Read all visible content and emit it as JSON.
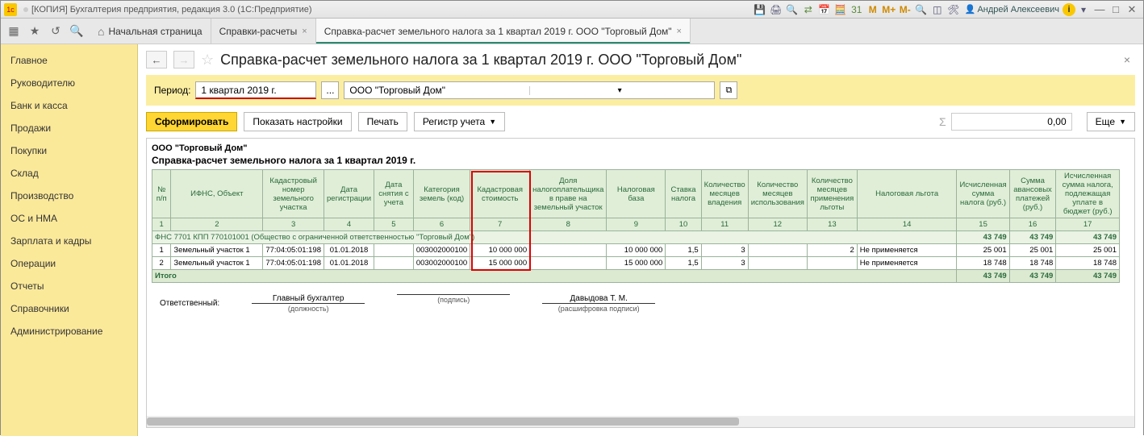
{
  "window": {
    "title": "[КОПИЯ] Бухгалтерия предприятия, редакция 3.0  (1С:Предприятие)",
    "user": "Андрей Алексеевич"
  },
  "toolbarIcons": {
    "m1": "M",
    "m2": "M+",
    "m3": "M-"
  },
  "tabs": {
    "home": "Начальная страница",
    "t1": "Справки-расчеты",
    "t2": "Справка-расчет земельного налога за 1 квартал 2019 г. ООО \"Торговый Дом\""
  },
  "sidebar": {
    "items": [
      "Главное",
      "Руководителю",
      "Банк и касса",
      "Продажи",
      "Покупки",
      "Склад",
      "Производство",
      "ОС и НМА",
      "Зарплата и кадры",
      "Операции",
      "Отчеты",
      "Справочники",
      "Администрирование"
    ]
  },
  "page": {
    "title": "Справка-расчет земельного налога за 1 квартал 2019 г. ООО \"Торговый Дом\"",
    "periodLabel": "Период:",
    "periodValue": "1 квартал 2019 г.",
    "org": "ООО \"Торговый Дом\"",
    "btnForm": "Сформировать",
    "btnSettings": "Показать настройки",
    "btnPrint": "Печать",
    "btnRegister": "Регистр учета",
    "sum": "0,00",
    "btnMore": "Еще"
  },
  "report": {
    "org": "ООО \"Торговый Дом\"",
    "title": "Справка-расчет земельного налога за 1 квартал 2019 г.",
    "headers": [
      "№ п/п",
      "ИФНС, Объект",
      "Кадастровый номер земельного участка",
      "Дата регистрации",
      "Дата снятия с учета",
      "Категория земель (код)",
      "Кадастровая стоимость",
      "Доля налогоплательщика в праве на земельный участок",
      "Налоговая база",
      "Ставка налога",
      "Количество месяцев владения",
      "Количество месяцев использования",
      "Количество месяцев применения льготы",
      "Налоговая льгота",
      "Исчисленная сумма налога (руб.)",
      "Сумма авансовых платежей (руб.)",
      "Исчисленная сумма налога, подлежащая уплате в бюджет (руб.)"
    ],
    "nums": [
      "1",
      "2",
      "3",
      "4",
      "5",
      "6",
      "7",
      "8",
      "9",
      "10",
      "11",
      "12",
      "13",
      "14",
      "15",
      "16",
      "17"
    ],
    "group": {
      "label": "ФНС 7701 КПП 770101001 (Общество с ограниченной ответственностью \"Торговый Дом\")",
      "v15": "43 749",
      "v16": "43 749",
      "v17": "43 749"
    },
    "rows": [
      {
        "n": "1",
        "obj": "Земельный участок 1",
        "kad": "77:04:05:01:198",
        "dreg": "01.01.2018",
        "dsn": "",
        "cat": "003002000100",
        "cost": "10 000 000",
        "share": "",
        "base": "10 000 000",
        "rate": "1,5",
        "mown": "3",
        "muse": "",
        "mlg": "2",
        "lg": "Не применяется",
        "s15": "25 001",
        "s16": "25 001",
        "s17": "25 001"
      },
      {
        "n": "2",
        "obj": "Земельный участок 1",
        "kad": "77:04:05:01:198",
        "dreg": "01.01.2018",
        "dsn": "",
        "cat": "003002000100",
        "cost": "15 000 000",
        "share": "",
        "base": "15 000 000",
        "rate": "1,5",
        "mown": "3",
        "muse": "",
        "mlg": "",
        "lg": "Не применяется",
        "s15": "18 748",
        "s16": "18 748",
        "s17": "18 748"
      }
    ],
    "total": {
      "label": "Итого",
      "v15": "43 749",
      "v16": "43 749",
      "v17": "43 749"
    },
    "sign": {
      "resp": "Ответственный:",
      "pos": "Главный бухгалтер",
      "posLbl": "(должность)",
      "sig": "",
      "sigLbl": "(подпись)",
      "name": "Давыдова Т. М.",
      "nameLbl": "(расшифровка подписи)"
    }
  }
}
